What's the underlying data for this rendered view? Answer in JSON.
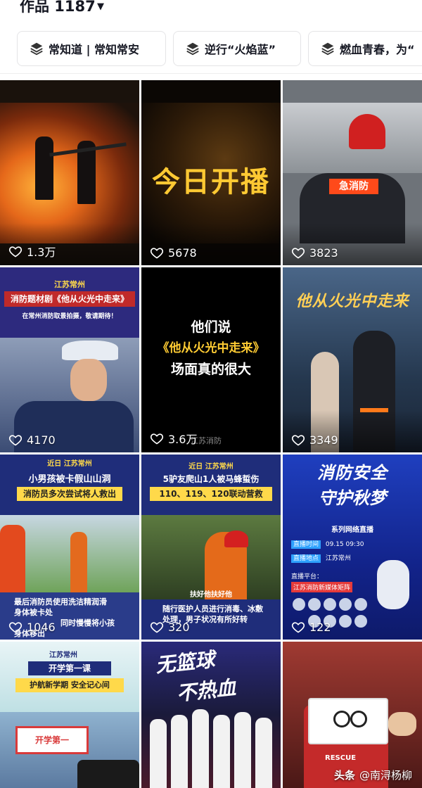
{
  "header": {
    "works_label": "作品 1187"
  },
  "collections": [
    {
      "label": "常知道 | 常知常安"
    },
    {
      "label": "逆行“火焰蓝”"
    },
    {
      "label": "燃血青春，为“"
    }
  ],
  "videos": [
    {
      "likes": "1.3万"
    },
    {
      "likes": "5678",
      "overlay": "今日开播"
    },
    {
      "likes": "3823",
      "badge": "急消防"
    },
    {
      "likes": "4170",
      "tag": "江苏常州",
      "title": "消防题材剧《他从火光中走来》",
      "subtitle": "在常州消防取景拍摄，敬请期待！"
    },
    {
      "likes": "3.6万",
      "line1": "他们说",
      "line2": "《他从火光中走来》",
      "line3": "场面真的很大",
      "logo": "江苏消防"
    },
    {
      "likes": "3349",
      "title": "他从火光中走来"
    },
    {
      "likes": "1046",
      "tag": "近日 江苏常州",
      "title1": "小男孩被卡假山山洞",
      "title2": "消防员多次尝试将人救出",
      "sub1": "最后消防员使用洗洁精润滑",
      "sub2": "身体被卡处",
      "sub3": "同时慢慢将小孩",
      "sub4": "身体移出"
    },
    {
      "likes": "320",
      "tag": "近日 江苏常州",
      "title1": "5驴友爬山1人被马蜂蜇伤",
      "title2": "110、119、120联动营救",
      "caption": "扶好他扶好他",
      "sub1": "随行医护人员进行消毒、冰敷",
      "sub2": "处理，男子状况有所好转"
    },
    {
      "likes": "122",
      "title1": "消防安全",
      "title2": "守护秋梦",
      "series": "系列网络直播",
      "time_label": "直播时间",
      "time": "09.15 09:30",
      "place_label": "直播地点",
      "place": "江苏常州",
      "platform_label": "直播平台：",
      "platform": "江苏消防新媒体矩阵"
    },
    {
      "tag": "江苏常州",
      "title1": "开学第一课",
      "title2": "护航新学期 安全记心间",
      "banner": "开学第一"
    },
    {
      "title1": "无篮球",
      "title2": "不热血"
    },
    {
      "truck_label": "RESCUE"
    }
  ],
  "watermark": {
    "brand": "头条",
    "handle": "@南浔杨柳"
  }
}
